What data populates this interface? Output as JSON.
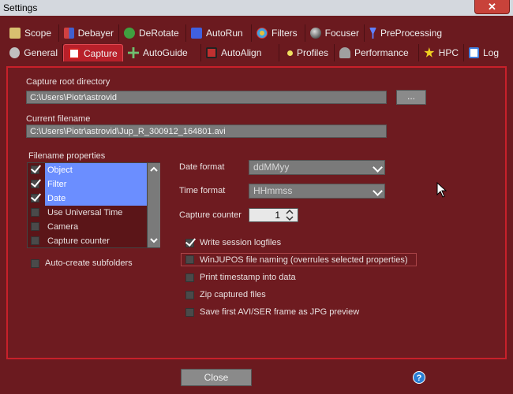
{
  "window": {
    "title": "Settings",
    "close_glyph": "✕"
  },
  "tabs_row1": [
    {
      "label": "Scope",
      "icon": "telescope-icon",
      "color": "#d8c070"
    },
    {
      "label": "Debayer",
      "icon": "color-squares-icon",
      "color": "#c84040"
    },
    {
      "label": "DeRotate",
      "icon": "rotate-icon",
      "color": "#40a040"
    },
    {
      "label": "AutoRun",
      "icon": "runner-icon",
      "color": "#4060e0"
    },
    {
      "label": "Filters",
      "icon": "filter-wheel-icon",
      "color": "#e0c040"
    },
    {
      "label": "Focuser",
      "icon": "focuser-ball-icon",
      "color": "#404040"
    },
    {
      "label": "PreProcessing",
      "icon": "funnel-icon",
      "color": "#6080ff"
    }
  ],
  "tabs_row2": [
    {
      "label": "General",
      "icon": "gears-icon",
      "color": "#c0c0c0"
    },
    {
      "label": "Capture",
      "icon": "camera-icon",
      "color": "#d02020"
    },
    {
      "label": "AutoGuide",
      "icon": "crosshair-arrows-icon",
      "color": "#70c070"
    },
    {
      "label": "AutoAlign",
      "icon": "align-icon",
      "color": "#c03030"
    },
    {
      "label": "Profiles",
      "icon": "bullet-icon",
      "color": "#f0e060"
    },
    {
      "label": "Performance",
      "icon": "dashboard-icon",
      "color": "#a0a0a0"
    },
    {
      "label": "HPC",
      "icon": "star-icon",
      "color": "#f0d020"
    },
    {
      "label": "Log",
      "icon": "log-info-icon",
      "color": "#4080e0"
    }
  ],
  "capture": {
    "root_dir_label": "Capture root directory",
    "root_dir_value": "C:\\Users\\Piotr\\astrovid",
    "browse_label": "...",
    "current_filename_label": "Current filename",
    "current_filename_value": "C:\\Users\\Piotr\\astrovid\\Jup_R_300912_164801.avi",
    "filename_props_label": "Filename properties",
    "props": [
      {
        "label": "Object",
        "checked": true,
        "selected": true
      },
      {
        "label": "Filter",
        "checked": true,
        "selected": true
      },
      {
        "label": "Date",
        "checked": true,
        "selected": true
      },
      {
        "label": "Use Universal Time",
        "checked": false,
        "selected": false
      },
      {
        "label": "Camera",
        "checked": false,
        "selected": false
      },
      {
        "label": "Capture counter",
        "checked": false,
        "selected": false
      }
    ],
    "auto_subfolders_label": "Auto-create subfolders",
    "date_format_label": "Date format",
    "date_format_value": "ddMMyy",
    "time_format_label": "Time format",
    "time_format_value": "HHmmss",
    "capture_counter_label": "Capture counter",
    "capture_counter_value": "1",
    "options": [
      {
        "label": "Write session logfiles",
        "checked": true
      },
      {
        "label": "WinJUPOS file naming (overrules selected properties)",
        "checked": false
      },
      {
        "label": "Print timestamp into data",
        "checked": false
      },
      {
        "label": "Zip captured files",
        "checked": false
      },
      {
        "label": "Save first AVI/SER frame as JPG preview",
        "checked": false
      }
    ]
  },
  "footer": {
    "close_label": "Close",
    "help_glyph": "?"
  }
}
